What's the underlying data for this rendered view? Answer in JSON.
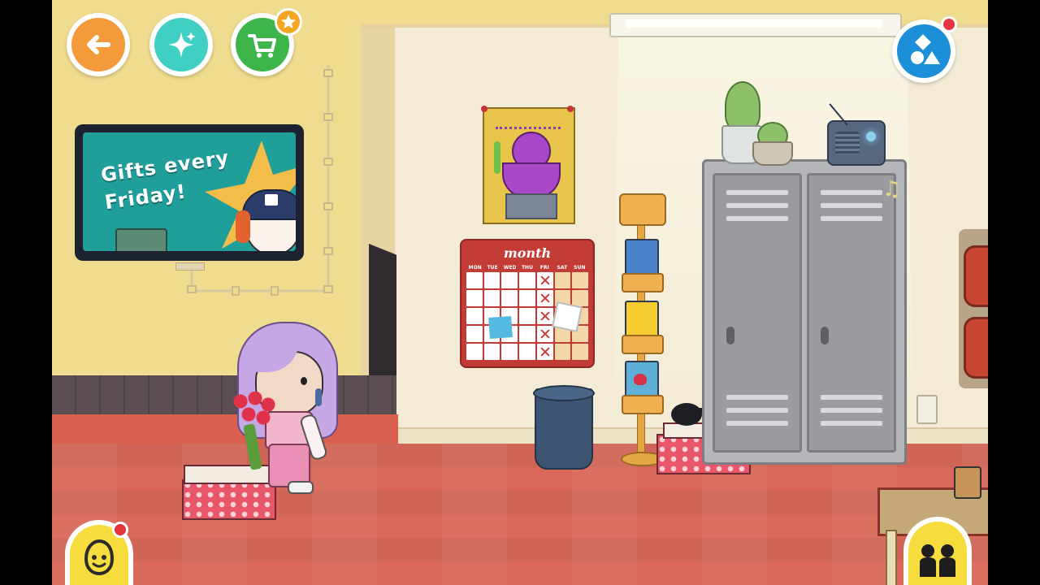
{
  "hud": {
    "back_icon": "arrow-left-icon",
    "magic_icon": "sparkle-icon",
    "shop_icon": "shopping-cart-icon",
    "shop_badge_icon": "star-icon",
    "design_icon": "shapes-icon",
    "design_notification": true,
    "colors": {
      "back": "#f39a3a",
      "magic": "#3fcfc3",
      "shop": "#3eb54a",
      "design": "#1d8ed8"
    }
  },
  "tv": {
    "line1": "Gifts every",
    "line2": "Friday!"
  },
  "calendar": {
    "title": "month",
    "days": [
      "MON",
      "TUE",
      "WED",
      "THU",
      "FRI",
      "SAT",
      "SUN"
    ]
  },
  "bottom": {
    "character_menu_icon": "character-face-icon",
    "character_menu_notification": true,
    "family_icon": "two-people-icon"
  },
  "colors": {
    "wall_left": "#f0dc8e",
    "wall_right": "#f3ebd6",
    "floor": "#d9685a",
    "locker": "#9a9ca0"
  }
}
